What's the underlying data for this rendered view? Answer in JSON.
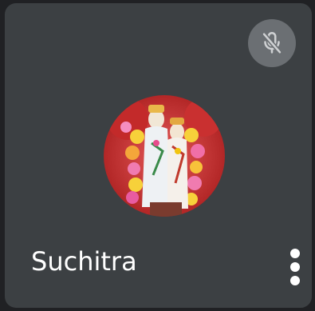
{
  "participant": {
    "name": "Suchitra",
    "mic_state": "muted",
    "mic_icon": "mic-off-icon",
    "menu_icon": "more-vert-icon",
    "avatar": "profile-photo"
  },
  "colors": {
    "tile_background": "#3c4043",
    "mic_button": "#6b6f73",
    "name_text": "#ffffff"
  }
}
